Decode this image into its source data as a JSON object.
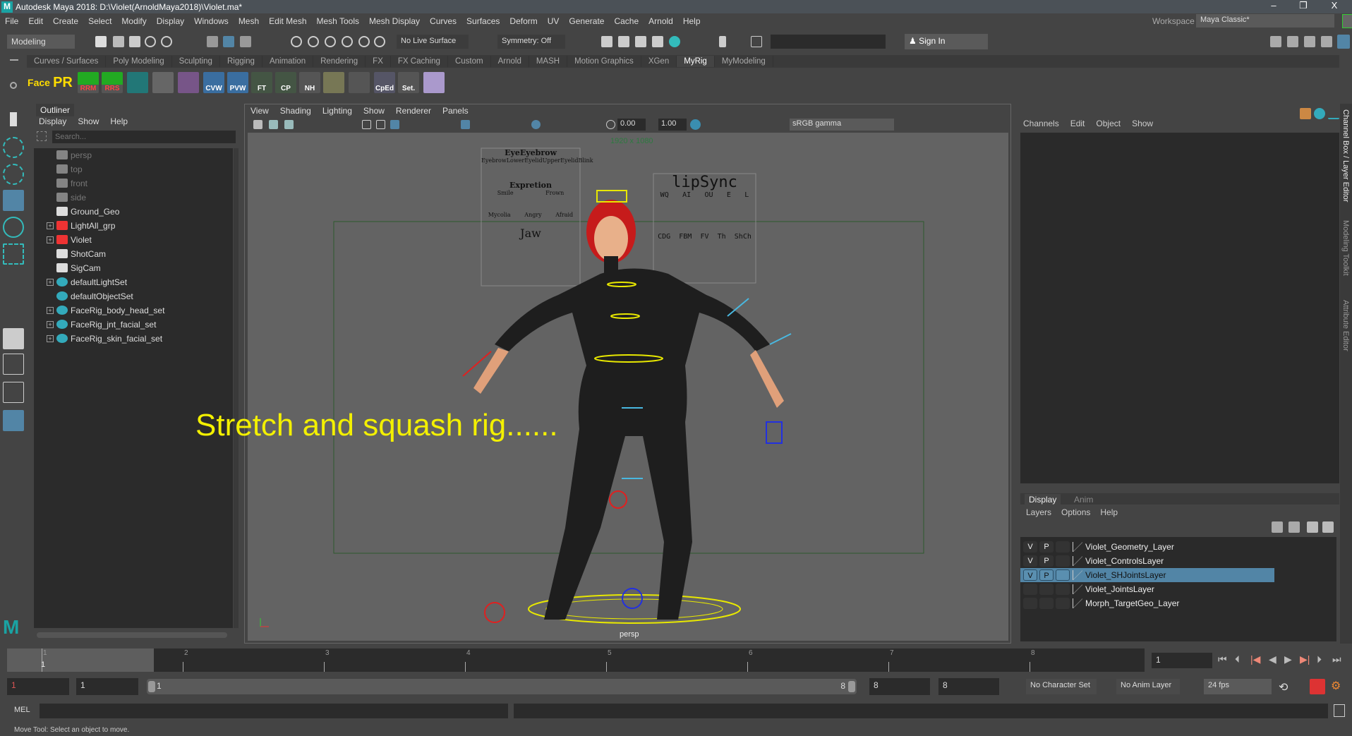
{
  "title": "Autodesk Maya 2018: D:\\Violet(ArnoldMaya2018)\\Violet.ma*",
  "window_controls": [
    "–",
    "❐",
    "X"
  ],
  "menus": [
    "File",
    "Edit",
    "Create",
    "Select",
    "Modify",
    "Display",
    "Windows",
    "Mesh",
    "Edit Mesh",
    "Mesh Tools",
    "Mesh Display",
    "Curves",
    "Surfaces",
    "Deform",
    "UV",
    "Generate",
    "Cache",
    "Arnold",
    "Help"
  ],
  "workspace": {
    "label": "Workspace :",
    "value": "Maya Classic*"
  },
  "status_line": {
    "menu_set": "Modeling",
    "live_surface": "No Live Surface",
    "symmetry": "Symmetry: Off",
    "sign_in": "Sign In"
  },
  "shelf_tabs": [
    "Curves / Surfaces",
    "Poly Modeling",
    "Sculpting",
    "Rigging",
    "Animation",
    "Rendering",
    "FX",
    "FX Caching",
    "Custom",
    "Arnold",
    "MASH",
    "Motion Graphics",
    "XGen",
    "MyRig",
    "MyModeling"
  ],
  "shelf_active": "MyRig",
  "shelf_buttons": [
    "Face",
    "PR",
    "RRM",
    "RRS",
    "",
    "",
    "",
    "CVW",
    "PVW",
    "FT",
    "CP",
    "NH",
    "",
    "",
    "CpEd",
    "Set.",
    ""
  ],
  "outliner": {
    "tab": "Outliner",
    "menus": [
      "Display",
      "Show",
      "Help"
    ],
    "search_placeholder": "Search...",
    "items": [
      {
        "label": "persp",
        "icon": "camera",
        "dim": true,
        "expand": false
      },
      {
        "label": "top",
        "icon": "camera",
        "dim": true,
        "expand": false
      },
      {
        "label": "front",
        "icon": "camera",
        "dim": true,
        "expand": false
      },
      {
        "label": "side",
        "icon": "camera",
        "dim": true,
        "expand": false
      },
      {
        "label": "Ground_Geo",
        "icon": "mesh",
        "dim": false,
        "expand": false
      },
      {
        "label": "LightAll_grp",
        "icon": "group",
        "dim": false,
        "expand": true
      },
      {
        "label": "Violet",
        "icon": "group",
        "dim": false,
        "expand": true
      },
      {
        "label": "ShotCam",
        "icon": "camera",
        "dim": false,
        "expand": false
      },
      {
        "label": "SigCam",
        "icon": "camera",
        "dim": false,
        "expand": false
      },
      {
        "label": "defaultLightSet",
        "icon": "set",
        "dim": false,
        "expand": true
      },
      {
        "label": "defaultObjectSet",
        "icon": "set",
        "dim": false,
        "expand": false
      },
      {
        "label": "FaceRig_body_head_set",
        "icon": "set",
        "dim": false,
        "expand": true
      },
      {
        "label": "FaceRig_jnt_facial_set",
        "icon": "set",
        "dim": false,
        "expand": true
      },
      {
        "label": "FaceRig_skin_facial_set",
        "icon": "set",
        "dim": false,
        "expand": true
      }
    ]
  },
  "viewport": {
    "menus": [
      "View",
      "Shading",
      "Lighting",
      "Show",
      "Renderer",
      "Panels"
    ],
    "exposure": "0.00",
    "gamma": "1.00",
    "color_space": "sRGB gamma",
    "resolution": "1920 x 1080",
    "camera": "persp",
    "overlay_text": "Stretch and squash rig......",
    "eye_panel": {
      "title": "EyeEyebrow",
      "labels": [
        "Eyebrow",
        "LowerEyelid",
        "UpperEyelid",
        "Blink"
      ],
      "expr_title": "Expretion",
      "expr": [
        "Smile",
        "Frown",
        "Mycolia",
        "Angry",
        "Afraid"
      ],
      "jaw": "Jaw"
    },
    "lip_panel": {
      "title": "lipSync",
      "top": [
        "WQ",
        "AI",
        "OU",
        "E",
        "L"
      ],
      "bottom": [
        "CDG",
        "FBM",
        "FV",
        "Th",
        "ShCh"
      ]
    }
  },
  "channel_box": {
    "menus": [
      "Channels",
      "Edit",
      "Object",
      "Show"
    ]
  },
  "side_tabs": [
    "Channel Box / Layer Editor",
    "Modeling Toolkit",
    "Attribute Editor"
  ],
  "layer_editor": {
    "tabs": [
      "Display",
      "Anim"
    ],
    "menus": [
      "Layers",
      "Options",
      "Help"
    ],
    "layers": [
      {
        "v": "V",
        "p": "P",
        "name": "Violet_Geometry_Layer",
        "selected": false
      },
      {
        "v": "V",
        "p": "P",
        "name": "Violet_ControlsLayer",
        "selected": false
      },
      {
        "v": "V",
        "p": "P",
        "name": "Violet_SHJointsLayer",
        "selected": true
      },
      {
        "v": "",
        "p": "",
        "name": "Violet_JointsLayer",
        "selected": false
      },
      {
        "v": "",
        "p": "",
        "name": "Morph_TargetGeo_Layer",
        "selected": false
      }
    ]
  },
  "timeline": {
    "ticks": [
      "1",
      "2",
      "3",
      "4",
      "5",
      "6",
      "7",
      "8"
    ],
    "current_marker": "1",
    "current_frame": "1"
  },
  "range": {
    "start": "1",
    "playback_start": "1",
    "slider_start": "1",
    "slider_end": "8",
    "playback_end": "8",
    "end": "8",
    "character_set": "No Character Set",
    "anim_layer": "No Anim Layer",
    "fps": "24 fps"
  },
  "command_line": {
    "label": "MEL"
  },
  "help_line": "Move Tool: Select an object to move.",
  "colors": {
    "accent": "#5285a6",
    "overlay": "#f3f000",
    "maya_teal": "#1aa3a3"
  }
}
